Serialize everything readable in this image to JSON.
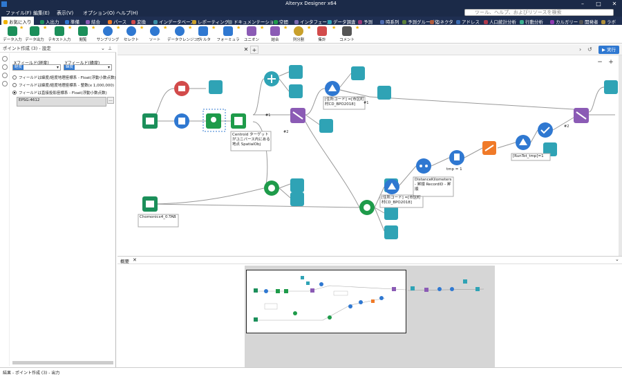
{
  "window": {
    "title": "Alteryx Designer x64",
    "minimize": "–",
    "maximize": "□",
    "close": "✕"
  },
  "menu": {
    "items": [
      "ファイル(F)",
      "編集(E)",
      "表示(V)",
      "オプション(O)",
      "ヘルプ(H)"
    ]
  },
  "search": {
    "placeholder": "ツール、ヘルプ、およびリソースを検索"
  },
  "categories": [
    {
      "label": "お気に入り",
      "color": "#f2b400"
    },
    {
      "label": "入出力",
      "color": "#1b8f5a"
    },
    {
      "label": "準備",
      "color": "#2f78d1"
    },
    {
      "label": "結合",
      "color": "#8b5bb5"
    },
    {
      "label": "パース",
      "color": "#f07a28"
    },
    {
      "label": "変換",
      "color": "#d24b4b"
    },
    {
      "label": "インデータベース",
      "color": "#3a8fa8"
    },
    {
      "label": "レポーティング",
      "color": "#c9a02b"
    },
    {
      "label": "ドキュメンテーション",
      "color": "#6a7b8c"
    },
    {
      "label": "空間",
      "color": "#1e9b4a"
    },
    {
      "label": "インタフェース",
      "color": "#7a6ab0"
    },
    {
      "label": "データ調査",
      "color": "#2fa3b5"
    },
    {
      "label": "予測",
      "color": "#9b3b7a"
    },
    {
      "label": "時系列",
      "color": "#4d6bb0"
    },
    {
      "label": "予測グループ化",
      "color": "#5b7f3a"
    },
    {
      "label": "コネクタ",
      "color": "#b05b3b"
    },
    {
      "label": "アドレス",
      "color": "#3b6bb0"
    },
    {
      "label": "人口統計分析",
      "color": "#b03b4d"
    },
    {
      "label": "行動分析",
      "color": "#3bb08f"
    },
    {
      "label": "カルガリー",
      "color": "#8f3bb0"
    },
    {
      "label": "開発者",
      "color": "#555555"
    },
    {
      "label": "ラボ",
      "color": "#b0903b"
    }
  ],
  "tools": [
    {
      "label": "データ入力",
      "color": "#1b8f5a"
    },
    {
      "label": "データ出力",
      "color": "#1b8f5a"
    },
    {
      "label": "テキスト入力",
      "color": "#1b8f5a"
    },
    {
      "label": "閲覧",
      "color": "#1b8f5a"
    },
    {
      "label": "サンプリング",
      "color": "#2f78d1"
    },
    {
      "label": "セレクト",
      "color": "#2f78d1"
    },
    {
      "label": "ソート",
      "color": "#2f78d1"
    },
    {
      "label": "データクレンジング",
      "color": "#2f78d1"
    },
    {
      "label": "フィルタ",
      "color": "#2f78d1"
    },
    {
      "label": "フォーミュラ",
      "color": "#2f78d1"
    },
    {
      "label": "ユニオン",
      "color": "#8b5bb5"
    },
    {
      "label": "結合",
      "color": "#8b5bb5"
    },
    {
      "label": "列分割",
      "color": "#c9a02b"
    },
    {
      "label": "集計",
      "color": "#d24b4b"
    },
    {
      "label": "コメント",
      "color": "#555555"
    }
  ],
  "config": {
    "header": "ポイント作成 (3) - 設定",
    "x_label": "Xフィールド(経度)",
    "x_value": "経度",
    "y_label": "Yフィールド(緯度)",
    "y_value": "緯度",
    "radio1": "フィールドは緯度/経度地理座標系 - Float(浮動小数点数)",
    "radio2": "フィールドは緯度/経度地理座標系 - 整数(x 1,000,000)",
    "radio3": "フィールドは直接投影座標系 - Float(浮動小数点数)",
    "epsg": "EPSG:4612",
    "epsg_btn": "..."
  },
  "status": "結果 - ポイント作成 (3) - 出力",
  "canvas": {
    "run_label": "実行",
    "annotations": {
      "centroid": "Centroid ターゲットがユニバース内にある地点 SpatialObj",
      "jusho1": "[住所コード] =[市区町村CD_BPO2018]",
      "jusho2": "[住所コード] =[市区町村CD_BPO2018]",
      "tmp": "tmp = 1",
      "distance": "DistanceKilometers - 昇順 RecordID - 昇順",
      "runtot": "[RunTot_tmp]=1",
      "chomon": "Chomonicx4_0.TAB",
      "l1": "#1",
      "l2": "#2",
      "l3": "#1",
      "l4": "#2"
    }
  },
  "overview": {
    "title": "概要"
  }
}
